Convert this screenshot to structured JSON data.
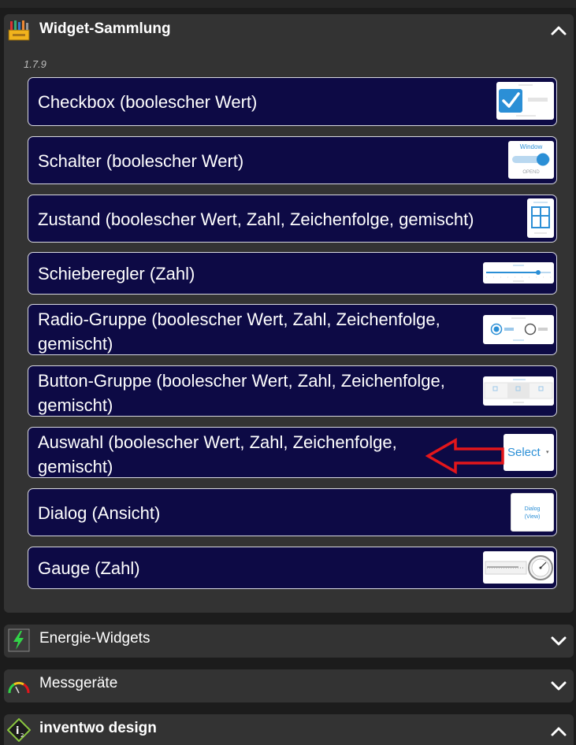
{
  "widget_collection": {
    "title": "Widget-Sammlung",
    "version": "1.7.9",
    "items": [
      {
        "label": "Checkbox (boolescher Wert)"
      },
      {
        "label": "Schalter (boolescher Wert)",
        "thumb_title": "Window",
        "thumb_caption": "OPEND"
      },
      {
        "label": "Zustand (boolescher Wert, Zahl, Zeichenfolge, gemischt)"
      },
      {
        "label": "Schieberegler (Zahl)"
      },
      {
        "label_line1": "Radio-Gruppe (boolescher Wert, Zahl, Zeichenfolge,",
        "label_line2": "gemischt)"
      },
      {
        "label_line1": "Button-Gruppe (boolescher Wert, Zahl, Zeichenfolge,",
        "label_line2": "gemischt)"
      },
      {
        "label_line1": "Auswahl (boolescher Wert, Zahl, Zeichenfolge,",
        "label_line2": "gemischt)",
        "thumb_text": "Select"
      },
      {
        "label": "Dialog (Ansicht)",
        "thumb_line1": "Dialog",
        "thumb_line2": "(View)"
      },
      {
        "label": "Gauge (Zahl)"
      }
    ]
  },
  "energy_widgets": {
    "title": "Energie-Widgets"
  },
  "gauges": {
    "title": "Messgeräte"
  },
  "inventwo": {
    "title": "inventwo design"
  },
  "colors": {
    "item_bg": "#0d0a45",
    "section_bg": "#333333",
    "page_bg": "#1c1c1c",
    "accent_blue": "#2b8fd6",
    "arrow_red": "#e3161b"
  }
}
